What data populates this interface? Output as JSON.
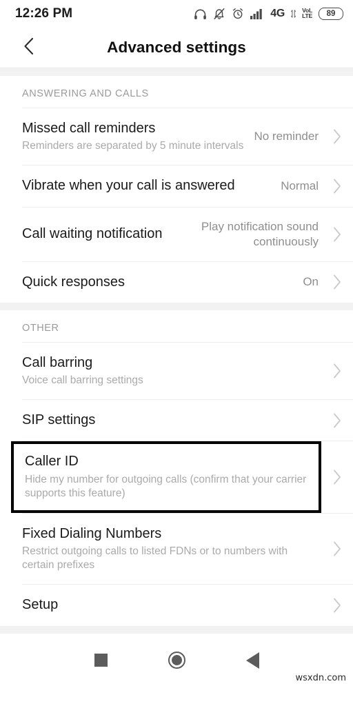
{
  "status_bar": {
    "time": "12:26 PM",
    "network_label": "4G",
    "volte_top": "VoL",
    "volte_bottom": "LTE",
    "battery_percent": "89",
    "icons": [
      "headphones-icon",
      "bell-muted-icon",
      "alarm-clock-icon",
      "signal-bars-icon",
      "data-transfer-icon"
    ]
  },
  "app_bar": {
    "back_icon": "chevron-left-icon",
    "title": "Advanced settings"
  },
  "sections": [
    {
      "header": "ANSWERING AND CALLS",
      "rows": [
        {
          "title": "Missed call reminders",
          "subtitle": "Reminders are separated by 5 minute intervals",
          "value": "No reminder",
          "highlighted": false
        },
        {
          "title": "Vibrate when your call is answered",
          "subtitle": "",
          "value": "Normal",
          "highlighted": false
        },
        {
          "title": "Call waiting notification",
          "subtitle": "",
          "value": "Play notification sound continuously",
          "highlighted": false
        },
        {
          "title": "Quick responses",
          "subtitle": "",
          "value": "On",
          "highlighted": false
        }
      ]
    },
    {
      "header": "OTHER",
      "rows": [
        {
          "title": "Call barring",
          "subtitle": "Voice call barring settings",
          "value": "",
          "highlighted": false
        },
        {
          "title": "SIP settings",
          "subtitle": "",
          "value": "",
          "highlighted": false
        },
        {
          "title": "Caller ID",
          "subtitle": "Hide my number for outgoing calls (confirm that your carrier supports this feature)",
          "value": "",
          "highlighted": true
        },
        {
          "title": "Fixed Dialing Numbers",
          "subtitle": "Restrict outgoing calls to listed FDNs or to numbers with certain prefixes",
          "value": "",
          "highlighted": false
        },
        {
          "title": "Setup",
          "subtitle": "",
          "value": "",
          "highlighted": false
        }
      ]
    }
  ],
  "nav_bar": {
    "recents_icon": "square-icon",
    "home_icon": "circle-icon",
    "back_icon": "triangle-left-icon"
  },
  "watermark": "wsxdn.com",
  "colors": {
    "highlight_border": "#000000",
    "band": "#f2f2f3",
    "divider": "#ededed",
    "secondary_text": "#aaaaaa"
  }
}
